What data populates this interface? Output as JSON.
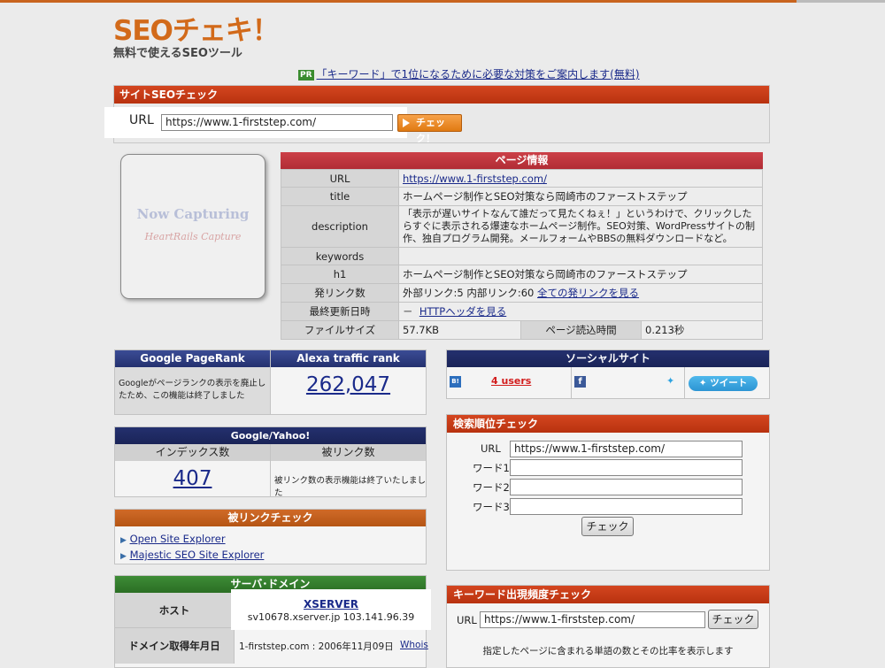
{
  "logo": {
    "main": "SEOチェキ！",
    "sub": "無料で使えるSEOツール"
  },
  "promo": {
    "badge": "PR",
    "text": "「キーワード」で1位になるために必要な対策をご案内します(無料)"
  },
  "site_check": {
    "header": "サイトSEOチェック",
    "url_label": "URL",
    "url_value": "https://www.1-firststep.com/",
    "button": "チェック！"
  },
  "capture": {
    "line1": "Now Capturing",
    "line2": "HeartRails Capture"
  },
  "page_info": {
    "header": "ページ情報",
    "rows": [
      {
        "key": "URL",
        "value": "https://www.1-firststep.com/"
      },
      {
        "key": "title",
        "value": "ホームページ制作とSEO対策なら岡崎市のファーストステップ"
      },
      {
        "key": "description",
        "value": "「表示が遅いサイトなんて誰だって見たくねぇ！」というわけで、クリックしたらすぐに表示される爆速なホームページ制作。SEO対策、WordPressサイトの制作、独自プログラム開発。メールフォームやBBSの無料ダウンロードなど。"
      },
      {
        "key": "keywords",
        "value": ""
      },
      {
        "key": "h1",
        "value": "ホームページ制作とSEO対策なら岡崎市のファーストステップ"
      }
    ],
    "links_key": "発リンク数",
    "links_value": "外部リンク:5  内部リンク:60",
    "links_more": "全ての発リンクを見る",
    "updated_key": "最終更新日時",
    "updated_dash": "－",
    "updated_link": "HTTPヘッダを見る",
    "size_key": "ファイルサイズ",
    "size_value": "57.7KB",
    "load_key": "ページ読込時間",
    "load_value": "0.213秒"
  },
  "pagerank": {
    "header": "Google PageRank",
    "text": "Googleがページランクの表示を廃止したため、この機能は終了しました"
  },
  "alexa": {
    "header": "Alexa traffic rank",
    "value": "262,047"
  },
  "google_yahoo": {
    "header": "Google/Yahoo!",
    "index_header": "インデックス数",
    "index_value": "407",
    "backlink_header": "被リンク数",
    "backlink_text": "被リンク数の表示機能は終了いたしました"
  },
  "backlink_check": {
    "header": "被リンクチェック",
    "links": [
      "Open Site Explorer",
      "Majestic SEO Site Explorer"
    ]
  },
  "server": {
    "header": "サーバ･ドメイン",
    "host_label": "ホスト",
    "host_name": "XSERVER",
    "host_detail": "sv10678.xserver.jp 103.141.96.39",
    "domain_label": "ドメイン取得年月日",
    "domain_value": "1-firststep.com : 2006年11月09日",
    "whois": "Whois"
  },
  "social": {
    "header": "ソーシャルサイト",
    "hatena_icon": "B!",
    "hatena_users": "4 users",
    "fb_icon": "f",
    "tweet": "ツイート"
  },
  "rank_check": {
    "header": "検索順位チェック",
    "url_label": "URL",
    "url_value": "https://www.1-firststep.com/",
    "word1": "ワード1",
    "word2": "ワード2",
    "word3": "ワード3",
    "button": "チェック"
  },
  "keyword_freq": {
    "header": "キーワード出現頻度チェック",
    "url_label": "URL",
    "url_value": "https://www.1-firststep.com/",
    "button": "チェック",
    "note": "指定したページに含まれる単語の数とその比率を表示します"
  }
}
